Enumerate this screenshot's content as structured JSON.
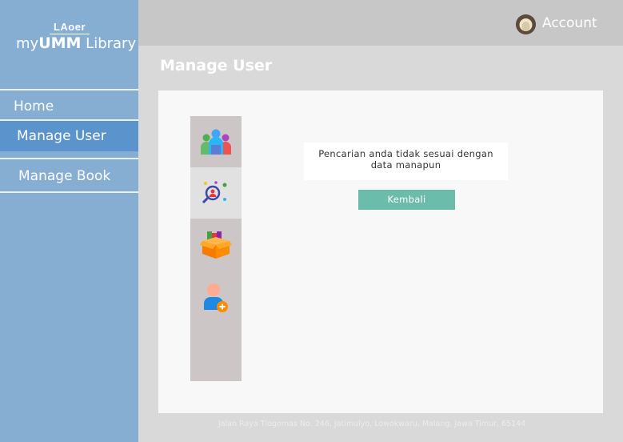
{
  "brand": {
    "small": "LAoer",
    "prefix": "my",
    "bold": "UMM",
    "suffix": " Library"
  },
  "nav": [
    {
      "label": "Home",
      "active": false
    },
    {
      "label": "Manage User",
      "active": true
    },
    {
      "label": "Manage Book",
      "active": false
    }
  ],
  "header": {
    "account_label": "Account"
  },
  "page": {
    "title": "Manage User"
  },
  "icons": [
    "users-icon",
    "search-user-icon",
    "books-box-icon",
    "add-user-icon"
  ],
  "message": {
    "line1": "Pencarian anda tidak sesuai dengan",
    "line2": "data manapun"
  },
  "back_button": "Kembali",
  "footer": "Jalan Raya Tlogomas No. 246, Jatimulyo, Lowokwaru, Malang, Jawa Timur, 65144",
  "colors": {
    "sidebar": "#86aed3",
    "active_nav": "#5b93cc",
    "button": "#6cbcab"
  }
}
